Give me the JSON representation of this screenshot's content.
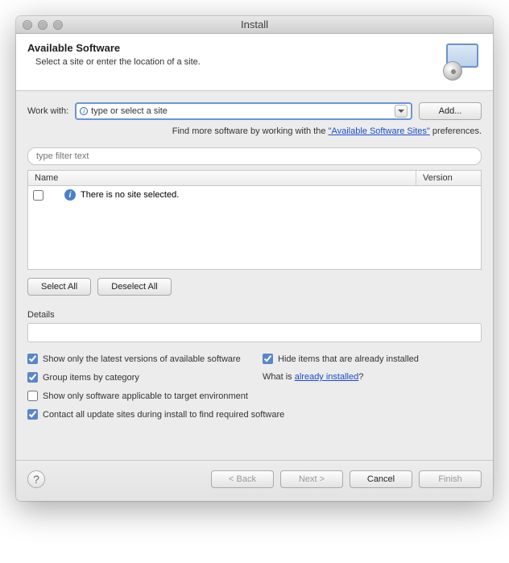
{
  "window": {
    "title": "Install"
  },
  "header": {
    "title": "Available Software",
    "subtitle": "Select a site or enter the location of a site."
  },
  "workwith": {
    "label": "Work with:",
    "value": "type or select a site",
    "add_label": "Add..."
  },
  "hint": {
    "prefix": "Find more software by working with the ",
    "link": "\"Available Software Sites\"",
    "suffix": " preferences."
  },
  "filter": {
    "placeholder": "type filter text"
  },
  "table": {
    "col_name": "Name",
    "col_version": "Version",
    "empty_msg": "There is no site selected."
  },
  "buttons": {
    "select_all": "Select All",
    "deselect_all": "Deselect All"
  },
  "details": {
    "label": "Details",
    "text": ""
  },
  "options": {
    "latest": {
      "label": "Show only the latest versions of available software",
      "checked": true
    },
    "hide_installed": {
      "label": "Hide items that are already installed",
      "checked": true
    },
    "group": {
      "label": "Group items by category",
      "checked": true
    },
    "what_prefix": "What is ",
    "what_link": "already installed",
    "what_suffix": "?",
    "target_env": {
      "label": "Show only software applicable to target environment",
      "checked": false
    },
    "contact_sites": {
      "label": "Contact all update sites during install to find required software",
      "checked": true
    }
  },
  "footer": {
    "back": "< Back",
    "next": "Next >",
    "cancel": "Cancel",
    "finish": "Finish"
  }
}
